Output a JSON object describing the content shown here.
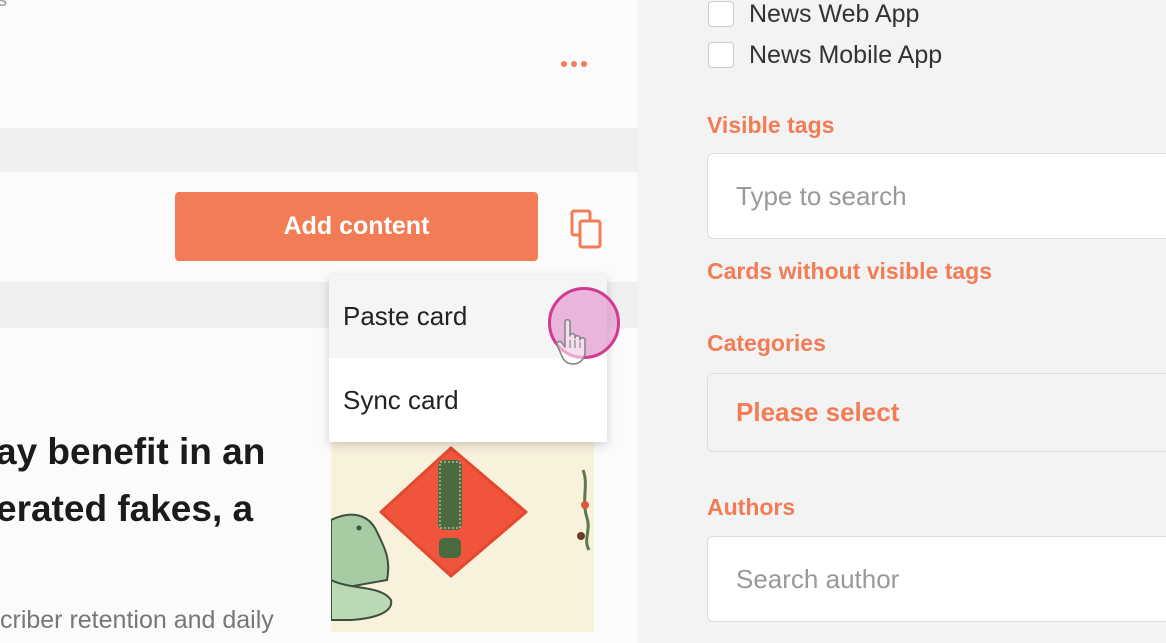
{
  "left": {
    "top_snippet": "s",
    "add_content_label": "Add content",
    "menu": {
      "items": [
        {
          "label": "Paste card"
        },
        {
          "label": "Sync card"
        }
      ]
    },
    "article": {
      "headline_line1": "ay benefit in an",
      "headline_line2": "erated fakes, a",
      "summary": "criber retention and daily"
    }
  },
  "right": {
    "checkboxes": [
      {
        "label": "News Web App",
        "checked": false
      },
      {
        "label": "News Mobile App",
        "checked": false
      }
    ],
    "visible_tags": {
      "label": "Visible tags",
      "placeholder": "Type to search"
    },
    "cards_without_tags": "Cards without visible tags",
    "categories": {
      "label": "Categories",
      "value": "Please select"
    },
    "authors": {
      "label": "Authors",
      "placeholder": "Search author"
    }
  },
  "colors": {
    "accent": "#f27c55",
    "cursor_ring": "#d2398f"
  }
}
